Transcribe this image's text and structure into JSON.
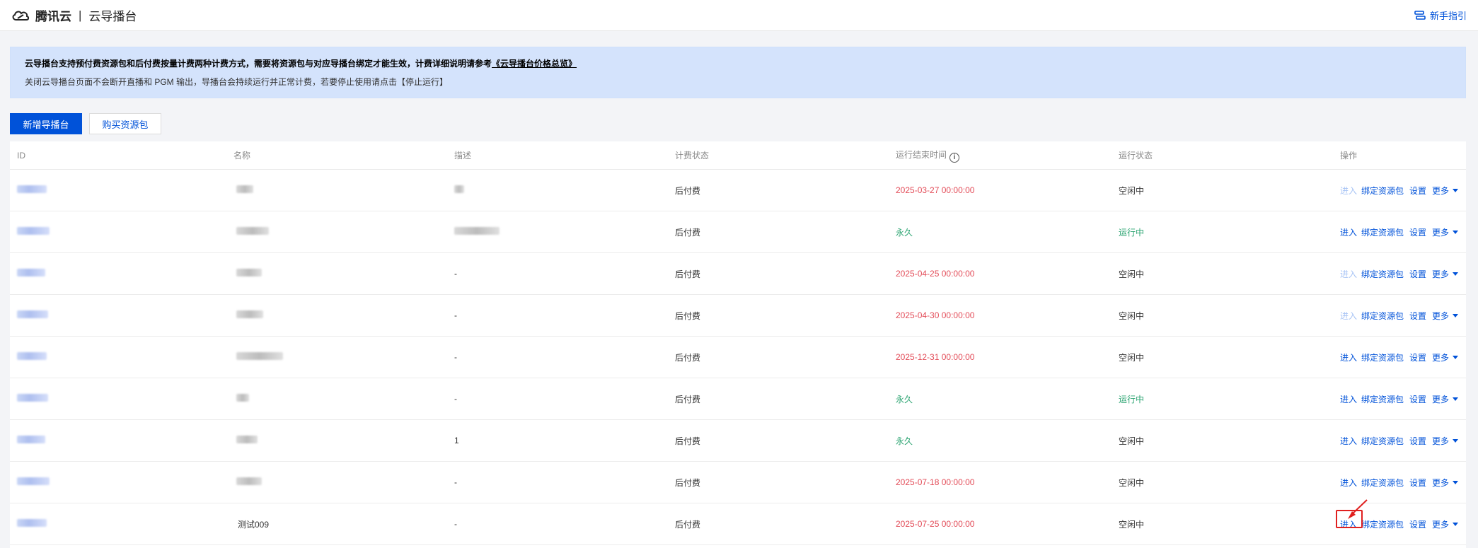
{
  "header": {
    "logo_text": "腾讯云",
    "product": "云导播台",
    "guide_label": "新手指引"
  },
  "notice": {
    "line1_text": "云导播台支持预付费资源包和后付费按量计费两种计费方式，需要将资源包与对应导播台绑定才能生效，计费详细说明请参考",
    "line1_link": "《云导播台价格总览》",
    "line2_text": "关闭云导播台页面不会断开直播和 PGM 输出，导播台会持续运行并正常计费，若要停止使用请点击",
    "line2_stop": "【停止运行】"
  },
  "toolbar": {
    "create_label": "新增导播台",
    "buy_label": "购买资源包"
  },
  "table": {
    "columns": {
      "id": "ID",
      "name": "名称",
      "desc": "描述",
      "billing": "计费状态",
      "end_time": "运行结束时间",
      "status": "运行状态",
      "ops": "操作"
    },
    "ops_labels": {
      "enter": "进入",
      "bind": "绑定资源包",
      "settings": "设置",
      "more": "更多"
    },
    "rows": [
      {
        "name": "",
        "desc": "",
        "billing": "后付费",
        "end_time": "2025-03-27 00:00:00",
        "end_color": "red",
        "status": "空闲中",
        "status_color": "normal",
        "enter_disabled": true
      },
      {
        "name": "",
        "desc": "",
        "billing": "后付费",
        "end_time": "永久",
        "end_color": "green",
        "status": "运行中",
        "status_color": "green",
        "enter_disabled": false
      },
      {
        "name": "",
        "desc": "-",
        "billing": "后付费",
        "end_time": "2025-04-25 00:00:00",
        "end_color": "red",
        "status": "空闲中",
        "status_color": "normal",
        "enter_disabled": true
      },
      {
        "name": "",
        "desc": "-",
        "billing": "后付费",
        "end_time": "2025-04-30 00:00:00",
        "end_color": "red",
        "status": "空闲中",
        "status_color": "normal",
        "enter_disabled": true
      },
      {
        "name": "",
        "desc": "-",
        "billing": "后付费",
        "end_time": "2025-12-31 00:00:00",
        "end_color": "red",
        "status": "空闲中",
        "status_color": "normal",
        "enter_disabled": false
      },
      {
        "name": "",
        "desc": "-",
        "billing": "后付费",
        "end_time": "永久",
        "end_color": "green",
        "status": "运行中",
        "status_color": "green",
        "enter_disabled": false
      },
      {
        "name": "",
        "desc": "1",
        "billing": "后付费",
        "end_time": "永久",
        "end_color": "green",
        "status": "空闲中",
        "status_color": "normal",
        "enter_disabled": false
      },
      {
        "name": "",
        "desc": "-",
        "billing": "后付费",
        "end_time": "2025-07-18 00:00:00",
        "end_color": "red",
        "status": "空闲中",
        "status_color": "normal",
        "enter_disabled": false
      },
      {
        "name": "测试009",
        "desc": "-",
        "billing": "后付费",
        "end_time": "2025-07-25 00:00:00",
        "end_color": "red",
        "status": "空闲中",
        "status_color": "normal",
        "enter_disabled": false,
        "highlighted": true
      }
    ]
  },
  "colors": {
    "primary": "#0052d9",
    "red": "#e34d59",
    "green": "#2ba471",
    "notice_bg": "#d4e3fc",
    "highlight": "#e0201f"
  }
}
